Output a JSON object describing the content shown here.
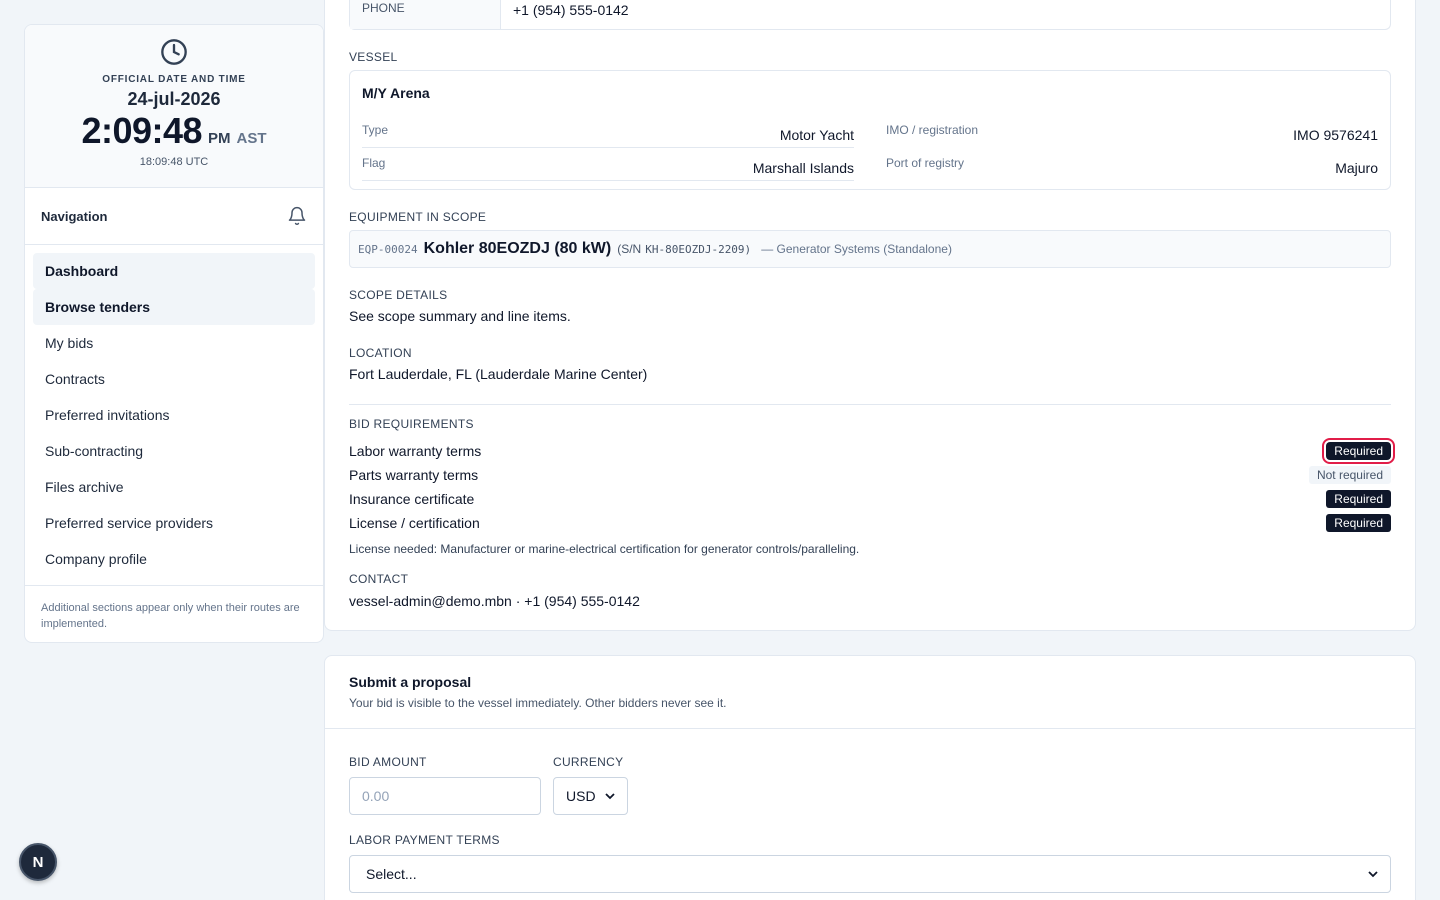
{
  "clock": {
    "label": "OFFICIAL DATE AND TIME",
    "date": "24-jul-2026",
    "time": "2:09:48",
    "ampm": "PM",
    "tz": "AST",
    "utc": "18:09:48 UTC"
  },
  "nav": {
    "title": "Navigation",
    "items": [
      {
        "label": "Dashboard"
      },
      {
        "label": "Browse tenders"
      },
      {
        "label": "My bids"
      },
      {
        "label": "Contracts"
      },
      {
        "label": "Preferred invitations"
      },
      {
        "label": "Sub-contracting"
      },
      {
        "label": "Files archive"
      },
      {
        "label": "Preferred service providers"
      },
      {
        "label": "Company profile"
      }
    ],
    "footer": "Additional sections appear only when their routes are implemented."
  },
  "phone": {
    "label": "PHONE",
    "value": "+1 (954) 555-0142"
  },
  "vessel": {
    "section": "VESSEL",
    "name": "M/Y Arena",
    "type_label": "Type",
    "type_value": "Motor Yacht",
    "imo_label": "IMO / registration",
    "imo_value": "IMO 9576241",
    "flag_label": "Flag",
    "flag_value": "Marshall Islands",
    "port_label": "Port of registry",
    "port_value": "Majuro"
  },
  "equipment": {
    "section": "EQUIPMENT IN SCOPE",
    "code": "EQP-00024",
    "name": "Kohler 80EOZDJ (80 kW)",
    "sn_prefix": "(S/N",
    "sn": "KH-80EOZDJ-2209)",
    "category": "— Generator Systems (Standalone)"
  },
  "scope": {
    "section": "SCOPE DETAILS",
    "value": "See scope summary and line items."
  },
  "location": {
    "section": "LOCATION",
    "value": "Fort Lauderdale, FL (Lauderdale Marine Center)"
  },
  "requirements": {
    "section": "BID REQUIREMENTS",
    "items": [
      {
        "label": "Labor warranty terms",
        "status": "Required"
      },
      {
        "label": "Parts warranty terms",
        "status": "Not required"
      },
      {
        "label": "Insurance certificate",
        "status": "Required"
      },
      {
        "label": "License / certification",
        "status": "Required"
      }
    ],
    "note": "License needed: Manufacturer or marine-electrical certification for generator controls/paralleling."
  },
  "contact": {
    "section": "CONTACT",
    "value": "vessel-admin@demo.mbn · +1 (954) 555-0142"
  },
  "proposal": {
    "title": "Submit a proposal",
    "subtitle": "Your bid is visible to the vessel immediately. Other bidders never see it.",
    "bid_amount_label": "BID AMOUNT",
    "bid_amount_placeholder": "0.00",
    "currency_label": "CURRENCY",
    "currency_value": "USD",
    "labor_terms_label": "LABOR PAYMENT TERMS",
    "labor_terms_value": "Select..."
  },
  "dev_badge": "N"
}
